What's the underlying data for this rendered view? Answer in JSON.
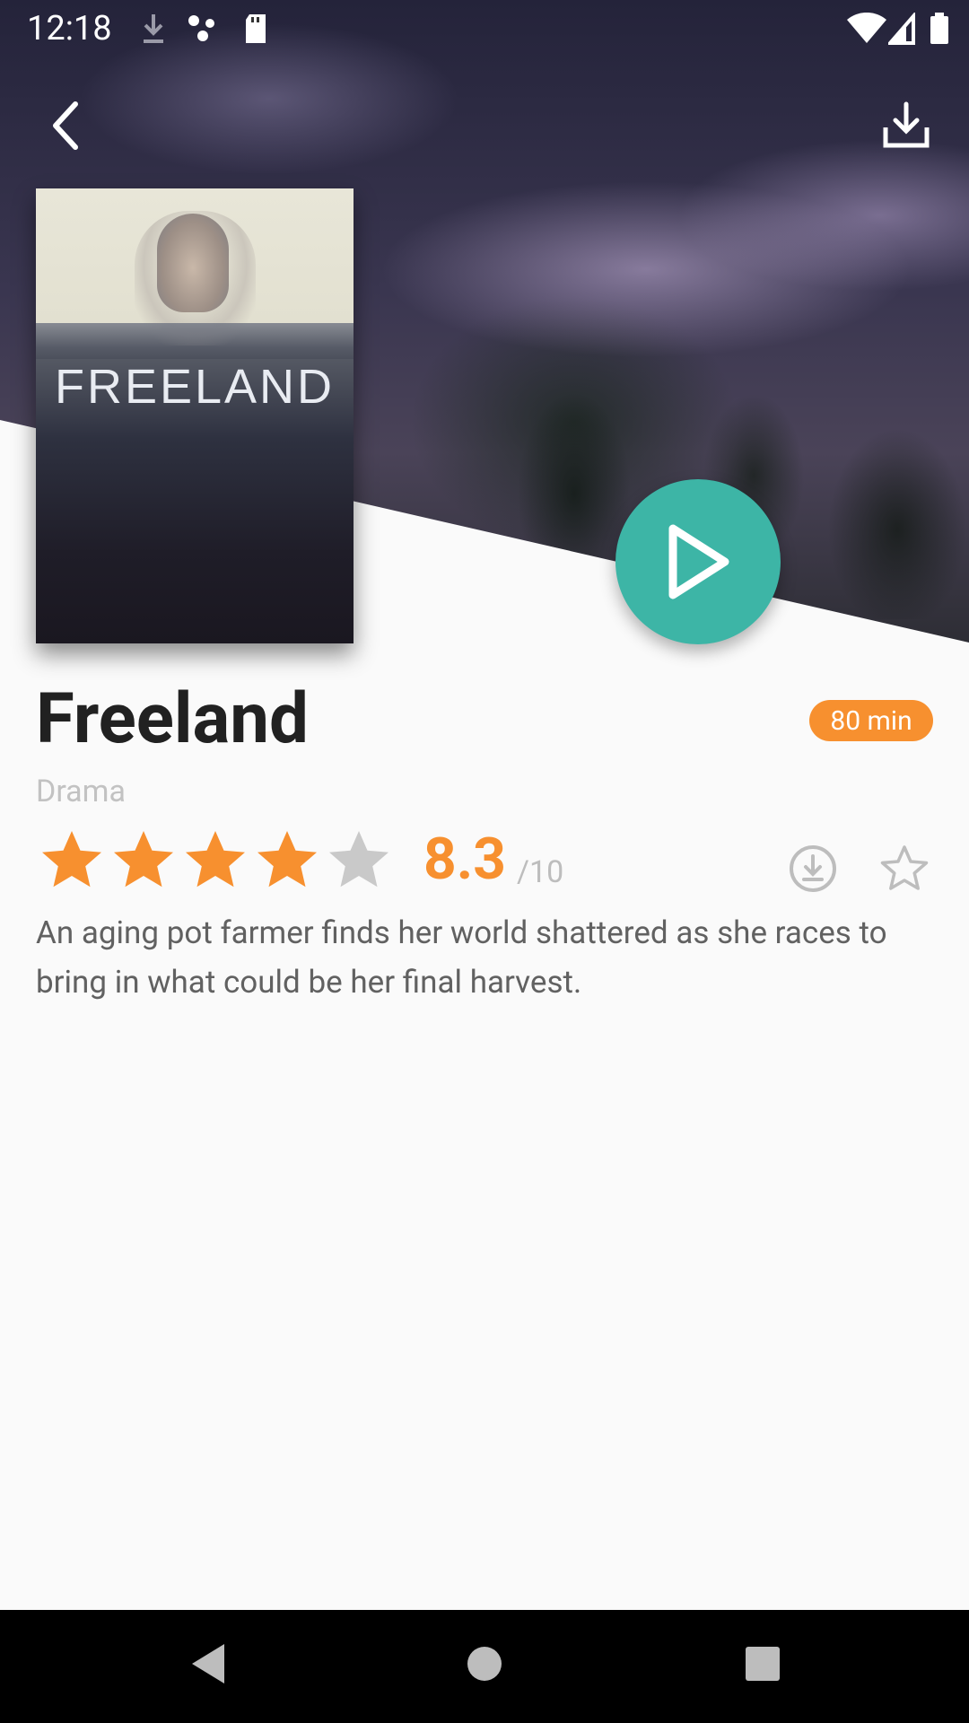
{
  "status_bar": {
    "time": "12:18"
  },
  "movie": {
    "poster_title": "FREELAND",
    "title": "Freeland",
    "duration": "80 min",
    "genre": "Drama",
    "stars_filled": 4,
    "stars_total": 5,
    "score": "8.3",
    "score_max": "/10",
    "description": "An aging pot farmer finds her world shattered as she races to bring in what could be her final harvest."
  },
  "colors": {
    "accent": "#f7902f",
    "play": "#3db5a6",
    "star_empty": "#c9c9c9"
  },
  "icons": [
    "back-arrow-icon",
    "download-icon",
    "play-icon",
    "download-circle-icon",
    "star-outline-icon"
  ]
}
